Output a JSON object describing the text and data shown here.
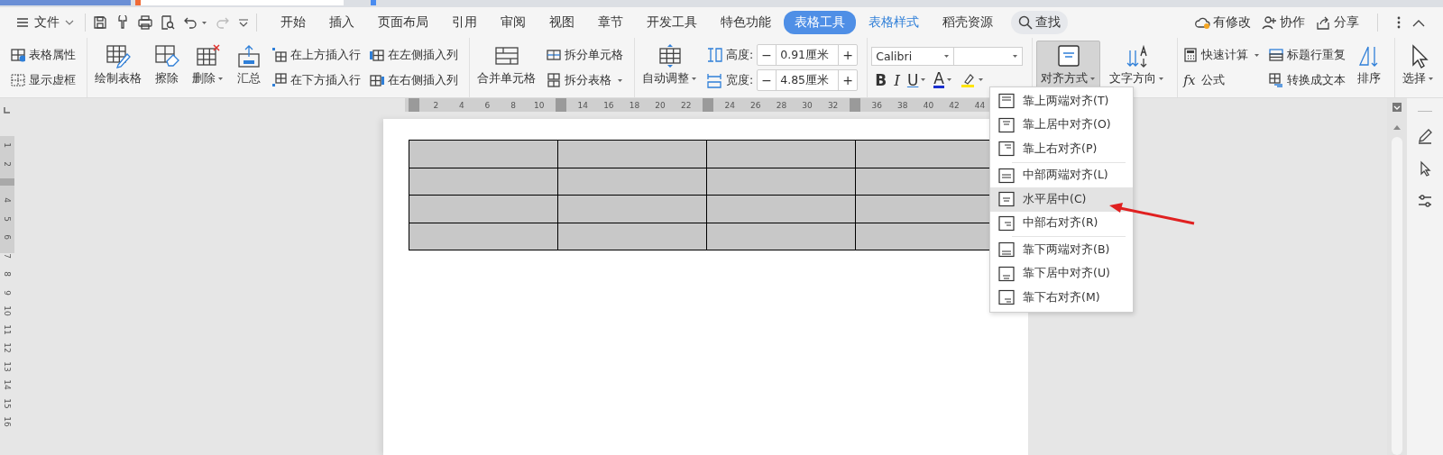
{
  "menu_bar": {
    "file_menu": "文件",
    "tabs": [
      {
        "label": "开始",
        "selected": false,
        "kind": "normal"
      },
      {
        "label": "插入",
        "selected": false,
        "kind": "normal"
      },
      {
        "label": "页面布局",
        "selected": false,
        "kind": "normal"
      },
      {
        "label": "引用",
        "selected": false,
        "kind": "normal"
      },
      {
        "label": "审阅",
        "selected": false,
        "kind": "normal"
      },
      {
        "label": "视图",
        "selected": false,
        "kind": "normal"
      },
      {
        "label": "章节",
        "selected": false,
        "kind": "normal"
      },
      {
        "label": "开发工具",
        "selected": false,
        "kind": "normal"
      },
      {
        "label": "特色功能",
        "selected": false,
        "kind": "normal"
      },
      {
        "label": "表格工具",
        "selected": true,
        "kind": "contextual"
      },
      {
        "label": "表格样式",
        "selected": false,
        "kind": "contextual"
      },
      {
        "label": "稻壳资源",
        "selected": false,
        "kind": "normal"
      }
    ],
    "search": "查找",
    "actions": [
      {
        "label": "有修改"
      },
      {
        "label": "协作"
      },
      {
        "label": "分享"
      }
    ]
  },
  "ribbon": [
    {
      "columns": [
        {
          "kind": "stack",
          "buttons": [
            {
              "label": "表格属性",
              "dropdown": false
            },
            {
              "label": "显示虚框",
              "dropdown": false
            }
          ]
        }
      ]
    },
    {
      "columns": [
        {
          "kind": "large",
          "label": "绘制表格",
          "dropdown": false,
          "pressed": false
        },
        {
          "kind": "large",
          "label": "擦除",
          "dropdown": false,
          "pressed": false
        },
        {
          "kind": "large",
          "label": "删除",
          "dropdown": true,
          "pressed": false
        },
        {
          "kind": "large",
          "label": "汇总",
          "dropdown": false,
          "pressed": false
        },
        {
          "kind": "stack",
          "buttons": [
            {
              "label": "在上方插入行",
              "dropdown": false
            },
            {
              "label": "在下方插入行",
              "dropdown": false
            }
          ]
        },
        {
          "kind": "stack",
          "buttons": [
            {
              "label": "在左侧插入列",
              "dropdown": false
            },
            {
              "label": "在右侧插入列",
              "dropdown": false
            }
          ]
        }
      ]
    },
    {
      "columns": [
        {
          "kind": "large",
          "label": "合并单元格",
          "dropdown": false,
          "pressed": false
        },
        {
          "kind": "stack",
          "buttons": [
            {
              "label": "拆分单元格",
              "dropdown": false
            },
            {
              "label": "拆分表格",
              "dropdown": true
            }
          ]
        }
      ]
    },
    {
      "columns": [
        {
          "kind": "large",
          "label": "自动调整",
          "dropdown": true,
          "pressed": false
        },
        {
          "kind": "spin",
          "rows": [
            {
              "label": "高度:",
              "value": "0.91厘米",
              "minus": "−",
              "plus": "+"
            },
            {
              "label": "宽度:",
              "value": "4.85厘米",
              "minus": "−",
              "plus": "+"
            }
          ]
        }
      ]
    },
    {
      "columns": [
        {
          "kind": "font",
          "font": "Calibri",
          "buttons": [
            {
              "kind": "letter",
              "label": "B",
              "dropdown": false
            },
            {
              "kind": "letter",
              "label": "I",
              "dropdown": false
            },
            {
              "kind": "letter",
              "label": "U",
              "dropdown": true
            },
            {
              "kind": "letter",
              "label": "A",
              "dropdown": true
            },
            {
              "kind": "icon",
              "dropdown": true
            }
          ]
        }
      ]
    },
    {
      "columns": [
        {
          "kind": "large",
          "label": "对齐方式",
          "dropdown": true,
          "pressed": true
        },
        {
          "kind": "large",
          "label": "文字方向",
          "dropdown": true,
          "pressed": false
        }
      ]
    },
    {
      "columns": [
        {
          "kind": "stack",
          "buttons": [
            {
              "label": "快速计算",
              "dropdown": true
            },
            {
              "label": "公式",
              "symbol": "fx",
              "dropdown": false
            }
          ]
        },
        {
          "kind": "stack",
          "buttons": [
            {
              "label": "标题行重复",
              "dropdown": false
            },
            {
              "label": "转换成文本",
              "dropdown": false
            }
          ]
        },
        {
          "kind": "large",
          "label": "排序",
          "dropdown": false,
          "pressed": false
        }
      ]
    },
    {
      "columns": [
        {
          "kind": "large",
          "label": "选择",
          "dropdown": true,
          "pressed": false
        }
      ]
    }
  ],
  "horizontal_ruler": [
    {
      "kind": "marker"
    },
    {
      "kind": "number",
      "label": "2"
    },
    {
      "kind": "number",
      "label": "4"
    },
    {
      "kind": "number",
      "label": "6"
    },
    {
      "kind": "number",
      "label": "8"
    },
    {
      "kind": "number",
      "label": "10"
    },
    {
      "kind": "marker"
    },
    {
      "kind": "number",
      "label": "14"
    },
    {
      "kind": "number",
      "label": "16"
    },
    {
      "kind": "number",
      "label": "18"
    },
    {
      "kind": "number",
      "label": "20"
    },
    {
      "kind": "number",
      "label": "22"
    },
    {
      "kind": "marker"
    },
    {
      "kind": "number",
      "label": "24"
    },
    {
      "kind": "number",
      "label": "26"
    },
    {
      "kind": "number",
      "label": "28"
    },
    {
      "kind": "number",
      "label": "30"
    },
    {
      "kind": "number",
      "label": "32"
    },
    {
      "kind": "marker"
    },
    {
      "kind": "number",
      "label": "36"
    },
    {
      "kind": "number",
      "label": "38"
    },
    {
      "kind": "number",
      "label": "40"
    },
    {
      "kind": "number",
      "label": "42"
    },
    {
      "kind": "number",
      "label": "44"
    }
  ],
  "vertical_ruler": [
    {
      "kind": "number",
      "label": "1"
    },
    {
      "kind": "number",
      "label": "2"
    },
    {
      "kind": "marker"
    },
    {
      "kind": "number",
      "label": "4"
    },
    {
      "kind": "number",
      "label": "5"
    },
    {
      "kind": "number",
      "label": "6"
    },
    {
      "kind": "number",
      "label": "7"
    },
    {
      "kind": "number",
      "label": "8"
    },
    {
      "kind": "number",
      "label": "9"
    },
    {
      "kind": "number",
      "label": "10"
    },
    {
      "kind": "number",
      "label": "11"
    },
    {
      "kind": "number",
      "label": "12"
    },
    {
      "kind": "number",
      "label": "13"
    },
    {
      "kind": "number",
      "label": "14"
    },
    {
      "kind": "number",
      "label": "15"
    },
    {
      "kind": "number",
      "label": "16"
    }
  ],
  "table": {
    "rows": [
      {
        "cells": [
          {
            "selected": true
          },
          {
            "selected": true
          },
          {
            "selected": true
          },
          {
            "selected": true
          }
        ]
      },
      {
        "cells": [
          {
            "selected": true
          },
          {
            "selected": true
          },
          {
            "selected": true
          },
          {
            "selected": true
          }
        ]
      },
      {
        "cells": [
          {
            "selected": true
          },
          {
            "selected": true
          },
          {
            "selected": true
          },
          {
            "selected": true
          }
        ]
      },
      {
        "cells": [
          {
            "selected": true
          },
          {
            "selected": true
          },
          {
            "selected": true
          },
          {
            "selected": true
          }
        ]
      }
    ]
  },
  "align_menu": {
    "sections": [
      [
        {
          "label": "靠上两端对齐(T)",
          "selected": false
        },
        {
          "label": "靠上居中对齐(O)",
          "selected": false
        },
        {
          "label": "靠上右对齐(P)",
          "selected": false
        }
      ],
      [
        {
          "label": "中部两端对齐(L)",
          "selected": false
        },
        {
          "label": "水平居中(C)",
          "selected": true
        },
        {
          "label": "中部右对齐(R)",
          "selected": false
        }
      ],
      [
        {
          "label": "靠下两端对齐(B)",
          "selected": false
        },
        {
          "label": "靠下居中对齐(U)",
          "selected": false
        },
        {
          "label": "靠下右对齐(M)",
          "selected": false
        }
      ]
    ]
  }
}
